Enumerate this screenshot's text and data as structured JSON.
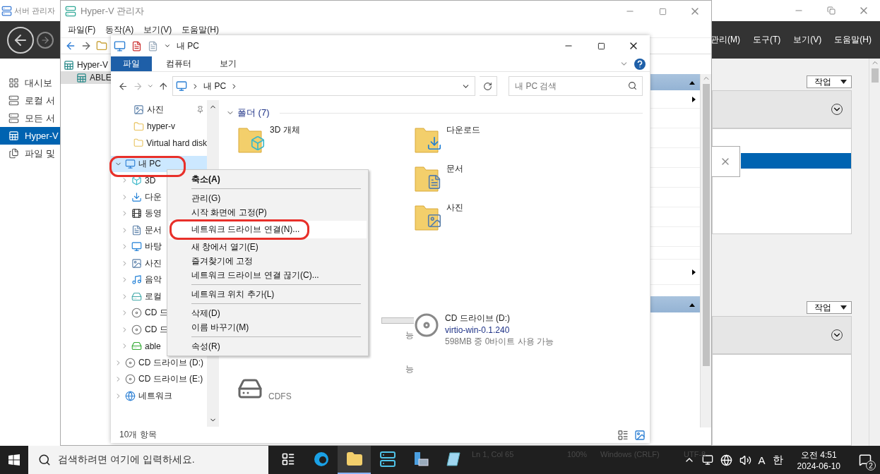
{
  "server_manager": {
    "title": "서버 관리자",
    "menu": [
      "관리(M)",
      "도구(T)",
      "보기(V)",
      "도움말(H)"
    ],
    "nav_items": [
      {
        "label": "대시보",
        "kind": "dashboard",
        "selected": false
      },
      {
        "label": "로컬 서",
        "kind": "server",
        "selected": false
      },
      {
        "label": "모든 서",
        "kind": "servers",
        "selected": false
      },
      {
        "label": "Hyper-V",
        "kind": "hyperv",
        "selected": true
      },
      {
        "label": "파일 및",
        "kind": "files",
        "selected": false
      }
    ],
    "task_buttons": [
      "작업",
      "작업"
    ]
  },
  "hyperv": {
    "title": "Hyper-V 관리자",
    "menu": [
      "파일(F)",
      "동작(A)",
      "보기(V)",
      "도움말(H)"
    ],
    "tree": [
      {
        "label": "Hyper-V",
        "selected": false,
        "children": [
          {
            "label": "ABLE",
            "selected": true
          }
        ]
      }
    ]
  },
  "explorer": {
    "title": "내 PC",
    "ribbon_tabs": [
      {
        "label": "파일",
        "selected": true
      },
      {
        "label": "컴퓨터",
        "selected": false
      },
      {
        "label": "보기",
        "selected": false
      }
    ],
    "address": "내 PC",
    "search": {
      "placeholder": "내 PC 검색"
    },
    "quick_access_tail": [
      {
        "label": "사진",
        "kind": "picture",
        "pinned": true
      },
      {
        "label": "hyper-v",
        "kind": "folder",
        "pinned": false
      },
      {
        "label": "Virtual hard disk",
        "kind": "folder",
        "pinned": false
      }
    ],
    "tree": [
      {
        "label": "내 PC",
        "kind": "pc",
        "expanded": true,
        "selected": true,
        "children": [
          {
            "label": "3D",
            "kind": "cube",
            "expanded": false,
            "selected": false
          },
          {
            "label": "다운",
            "kind": "download",
            "expanded": false,
            "selected": false
          },
          {
            "label": "동영",
            "kind": "video",
            "expanded": false,
            "selected": false
          },
          {
            "label": "문서",
            "kind": "document",
            "expanded": false,
            "selected": false
          },
          {
            "label": "바탕",
            "kind": "desktop",
            "expanded": false,
            "selected": false
          },
          {
            "label": "사진",
            "kind": "picture",
            "expanded": false,
            "selected": false
          },
          {
            "label": "음악",
            "kind": "music",
            "expanded": false,
            "selected": false
          },
          {
            "label": "로컬",
            "kind": "disk",
            "expanded": false,
            "selected": false
          },
          {
            "label": "CD 드",
            "kind": "cd",
            "expanded": false,
            "selected": false
          },
          {
            "label": "CD 드",
            "kind": "cd",
            "expanded": false,
            "selected": false
          },
          {
            "label": "able",
            "kind": "netdrive",
            "expanded": false,
            "selected": false
          }
        ]
      },
      {
        "label": "CD 드라이브 (D:)",
        "kind": "cd",
        "expanded": false,
        "selected": false
      },
      {
        "label": "CD 드라이브 (E:)",
        "kind": "cd",
        "expanded": false,
        "selected": false
      },
      {
        "label": "네트워크",
        "kind": "network",
        "expanded": false,
        "selected": false
      }
    ],
    "group": "폴더 (7)",
    "folders": [
      {
        "label": "3D 개체",
        "kind": "cube"
      },
      {
        "label": "다운로드",
        "kind": "download"
      },
      {
        "label": "문서",
        "kind": "document"
      },
      {
        "label": "사진",
        "kind": "picture"
      }
    ],
    "drive_fragments": {
      "tails": [
        "능",
        "능"
      ],
      "filesystem": "CDFS"
    },
    "drives": [
      {
        "name": "CD 드라이브 (D:)",
        "label": "virtio-win-0.1.240",
        "space": "598MB 중 0바이트 사용 가능"
      }
    ],
    "status": "10개 항목"
  },
  "context_menu": [
    {
      "kind": "item",
      "label": "축소(A)",
      "default": true,
      "selected": false
    },
    {
      "kind": "separator"
    },
    {
      "kind": "item",
      "label": "관리(G)",
      "default": false,
      "selected": false
    },
    {
      "kind": "item",
      "label": "시작 화면에 고정(P)",
      "default": false,
      "selected": false
    },
    {
      "kind": "item",
      "label": "네트워크 드라이브 연결(N)...",
      "default": false,
      "selected": true
    },
    {
      "kind": "item",
      "label": "새 창에서 열기(E)",
      "default": false,
      "selected": false
    },
    {
      "kind": "item",
      "label": "즐겨찾기에 고정",
      "default": false,
      "selected": false
    },
    {
      "kind": "item",
      "label": "네트워크 드라이브 연결 끊기(C)...",
      "default": false,
      "selected": false
    },
    {
      "kind": "separator"
    },
    {
      "kind": "item",
      "label": "네트워크 위치 추가(L)",
      "default": false,
      "selected": false
    },
    {
      "kind": "separator"
    },
    {
      "kind": "item",
      "label": "삭제(D)",
      "default": false,
      "selected": false
    },
    {
      "kind": "item",
      "label": "이름 바꾸기(M)",
      "default": false,
      "selected": false
    },
    {
      "kind": "separator"
    },
    {
      "kind": "item",
      "label": "속성(R)",
      "default": false,
      "selected": false
    }
  ],
  "notepad_status": [
    "Ln 1, Col 65",
    "100%",
    "Windows (CRLF)",
    "UTF-8"
  ],
  "taskbar": {
    "search": {
      "placeholder": "검색하려면 여기에 입력하세요."
    },
    "apps": [
      {
        "kind": "taskview",
        "active": false
      },
      {
        "kind": "edge",
        "active": false
      },
      {
        "kind": "explorer",
        "active": true
      },
      {
        "kind": "hyperv",
        "active": false
      },
      {
        "kind": "server",
        "active": false
      },
      {
        "kind": "notepad",
        "active": false
      }
    ],
    "tray": [
      "A",
      "한"
    ],
    "time": "오전 4:51",
    "date": "2024-06-10",
    "notifications": "2"
  }
}
